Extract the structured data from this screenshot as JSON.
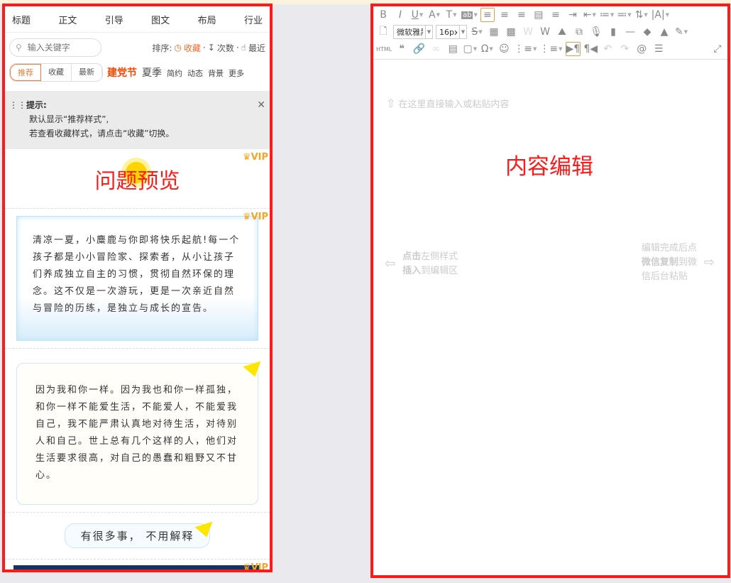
{
  "left": {
    "categories": [
      "标题",
      "正文",
      "引导",
      "图文",
      "布局",
      "行业"
    ],
    "search_placeholder": "输入关键字",
    "sort": {
      "label": "排序:",
      "options": [
        "收藏",
        "次数",
        "最近"
      ]
    },
    "segments": [
      "推荐",
      "收藏",
      "最新"
    ],
    "tags": [
      "建党节",
      "夏季",
      "简约",
      "动态",
      "背景",
      "更多"
    ],
    "tip": {
      "title": "提示:",
      "lines": [
        "默认显示“推荐样式”,",
        "若查看收藏样式，请点击“收藏”切换。"
      ]
    },
    "vip_label": "VIP",
    "preview_label": "问题预览",
    "card2_text": "清凉一夏，小麋鹿与你即将快乐起航!每一个孩子都是小小冒险家、探索者，从小让孩子们养成独立自主的习惯，贯彻自然环保的理念。这不仅是一次游玩，更是一次亲近自然与冒险的历练，是独立与成长的宣告。",
    "card3_text": "因为我和你一样。因为我也和你一样孤独，和你一样不能爱生活，不能爱人，不能爱我自己，我不能严肃认真地对待生活，对待别人和自己。世上总有几个这样的人，他们对生活要求很高，对自己的愚蠢和粗野又不甘心。",
    "card4_text": "有很多事， 不用解释"
  },
  "right": {
    "font_family": "微软雅黑",
    "font_size": "16px",
    "toolbar_rows": [
      [
        "bold",
        "italic",
        "underline*",
        "font-color*",
        "text-background*",
        "highlight*",
        "align-left!",
        "align-center",
        "align-right",
        "align-justify-top",
        "align-justify",
        "indent",
        "outdent*",
        "paragraph-spacing-top*",
        "paragraph-spacing-bottom*",
        "line-height*",
        "letter-spacing*"
      ],
      [
        "new-document",
        "FONTSEL",
        "strikethrough*",
        "table",
        "image-table",
        "word-disabled",
        "word",
        "image",
        "multi-image",
        "microphone",
        "video",
        "horizontal-rule",
        "eraser",
        "format-brush",
        "magic-wand*"
      ],
      [
        "html",
        "quote",
        "link",
        "unlink",
        "table-title",
        "border*",
        "special-char*",
        "emoji",
        "ordered-list*",
        "unordered-list*",
        "ltr!",
        "rtl",
        "undo",
        "redo",
        "search",
        "justify-text",
        "fullscreen"
      ]
    ],
    "editor": {
      "placeholder": "在这里直接输入或粘贴内容",
      "title": "内容编辑",
      "hint_left_bold1": "点击",
      "hint_left_1": "左侧样式",
      "hint_left_bold2": "插入",
      "hint_left_2": "到编辑区",
      "hint_right_1": "编辑完成后点",
      "hint_right_bold": "微信复制",
      "hint_right_2": "到微",
      "hint_right_3": "信后台粘贴"
    }
  },
  "colors": {
    "accent": "#f06a2a",
    "highlight_border": "#ff1a1a",
    "vip": "#f5a623"
  }
}
